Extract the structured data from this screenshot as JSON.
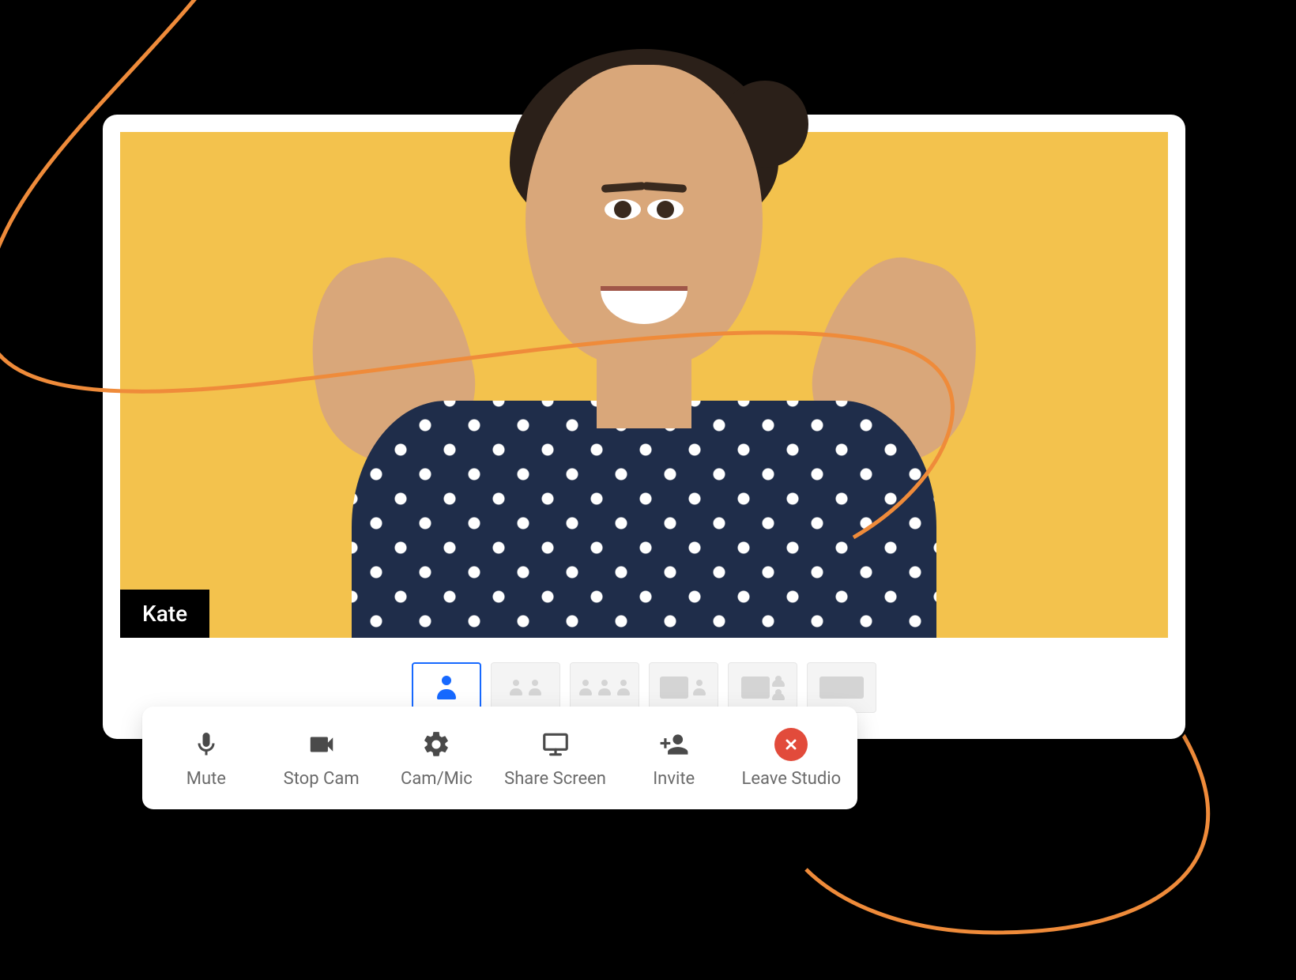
{
  "participant": {
    "name": "Kate"
  },
  "layouts": [
    {
      "id": "single",
      "active": true
    },
    {
      "id": "two-up",
      "active": false
    },
    {
      "id": "three-up",
      "active": false
    },
    {
      "id": "screen-one",
      "active": false
    },
    {
      "id": "screen-two",
      "active": false
    },
    {
      "id": "screen-full",
      "active": false
    }
  ],
  "toolbar": {
    "mute": "Mute",
    "stop_cam": "Stop Cam",
    "cam_mic": "Cam/Mic",
    "share_screen": "Share Screen",
    "invite": "Invite",
    "leave": "Leave Studio"
  },
  "colors": {
    "accent": "#1769ff",
    "danger": "#e24b3b",
    "video_bg": "#f3c24d",
    "swoosh": "#ef8b3a"
  }
}
